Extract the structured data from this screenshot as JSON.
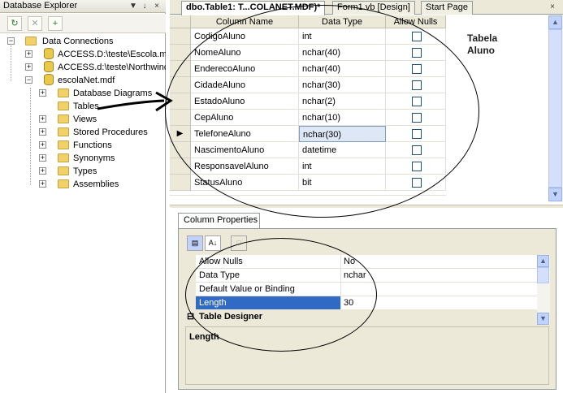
{
  "explorer": {
    "title": "Database Explorer",
    "title_buttons": [
      "▼",
      "↓",
      "×"
    ],
    "toolbar_icons": [
      "refresh-icon",
      "delete-icon",
      "add-connection-icon"
    ],
    "tree": {
      "root": "Data Connections",
      "connections": [
        "ACCESS.D:\\teste\\Escola.md",
        "ACCESS.d:\\teste\\Northwind"
      ],
      "db": "escolaNet.mdf",
      "folders": [
        "Database Diagrams",
        "Tables",
        "Views",
        "Stored Procedures",
        "Functions",
        "Synonyms",
        "Types",
        "Assemblies"
      ]
    }
  },
  "tabs": [
    {
      "label": "dbo.Table1: T...COLANET.MDF)*",
      "active": true
    },
    {
      "label": "Form1.vb [Design]",
      "active": false
    },
    {
      "label": "Start Page",
      "active": false
    }
  ],
  "tab_close": "×",
  "grid": {
    "headers": [
      "Column Name",
      "Data Type",
      "Allow Nulls"
    ],
    "rows": [
      {
        "name": "CodigoAluno",
        "type": "int",
        "nulls": false
      },
      {
        "name": "NomeAluno",
        "type": "nchar(40)",
        "nulls": false
      },
      {
        "name": "EnderecoAluno",
        "type": "nchar(40)",
        "nulls": false
      },
      {
        "name": "CidadeAluno",
        "type": "nchar(30)",
        "nulls": false
      },
      {
        "name": "EstadoAluno",
        "type": "nchar(2)",
        "nulls": false
      },
      {
        "name": "CepAluno",
        "type": "nchar(10)",
        "nulls": false
      },
      {
        "name": "TelefoneAluno",
        "type": "nchar(30)",
        "nulls": false
      },
      {
        "name": "NascimentoAluno",
        "type": "datetime",
        "nulls": false
      },
      {
        "name": "ResponsavelAluno",
        "type": "int",
        "nulls": false
      },
      {
        "name": "StatusAluno",
        "type": "bit",
        "nulls": false
      }
    ],
    "current_row_marker": "▶"
  },
  "annotation": {
    "line1": "Tabela",
    "line2": "Aluno"
  },
  "properties": {
    "tab_label": "Column Properties",
    "rows": [
      {
        "key": "Allow Nulls",
        "value": "No"
      },
      {
        "key": "Data Type",
        "value": "nchar"
      },
      {
        "key": "Default Value or Binding",
        "value": ""
      },
      {
        "key": "Length",
        "value": "30"
      }
    ],
    "category": "Table Designer",
    "category_toggle": "⊟",
    "description": "Length"
  }
}
